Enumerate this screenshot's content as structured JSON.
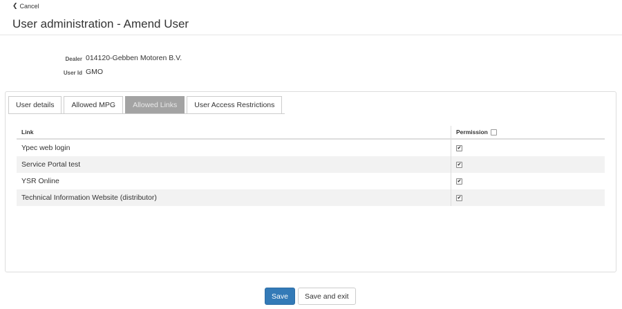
{
  "nav": {
    "cancel_label": "Cancel"
  },
  "page": {
    "title": "User administration - Amend User"
  },
  "info": {
    "dealer_label": "Dealer",
    "dealer_value": "014120-Gebben Motoren B.V.",
    "userid_label": "User Id",
    "userid_value": "GMO"
  },
  "tabs": [
    {
      "label": "User details",
      "active": false
    },
    {
      "label": "Allowed MPG",
      "active": false
    },
    {
      "label": "Allowed Links",
      "active": true
    },
    {
      "label": "User Access Restrictions",
      "active": false
    }
  ],
  "table": {
    "col_link": "Link",
    "col_permission": "Permission",
    "header_checked": false,
    "rows": [
      {
        "link": "Ypec web login",
        "checked": true
      },
      {
        "link": "Service Portal test",
        "checked": true
      },
      {
        "link": "YSR Online",
        "checked": true
      },
      {
        "link": "Technical Information Website (distributor)",
        "checked": true
      }
    ]
  },
  "actions": {
    "save_label": "Save",
    "save_exit_label": "Save and exit"
  },
  "colors": {
    "primary": "#337ab7",
    "active_tab": "#a3a3a3",
    "stripe": "#f2f2f2"
  }
}
